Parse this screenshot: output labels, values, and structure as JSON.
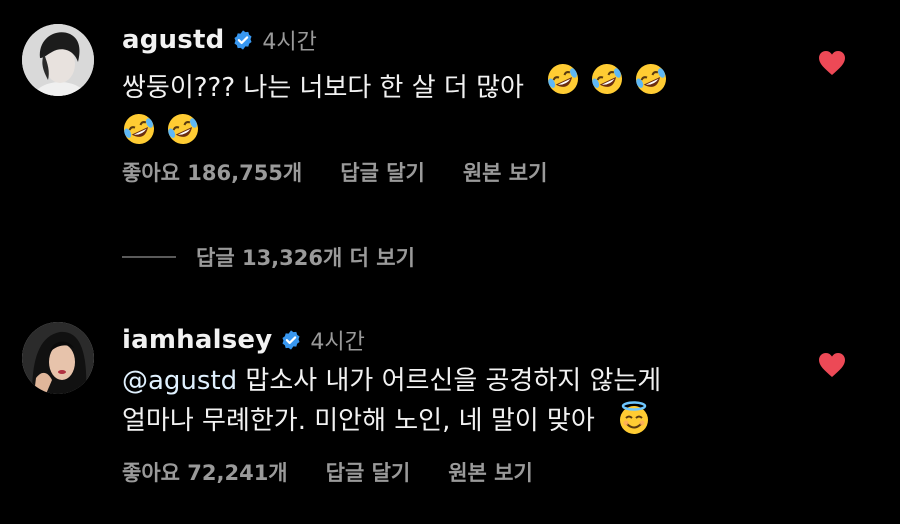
{
  "comments": [
    {
      "username": "agustd",
      "time": "4시간",
      "text_line1": "쌍둥이??? 나는 너보다 한 살 더 많아",
      "likes": "좋아요 186,755개",
      "reply_label": "답글 달기",
      "original_label": "원본 보기",
      "view_replies": "답글 13,326개 더 보기",
      "emoji_line1": [
        "rolling-on-floor-laughing",
        "rolling-on-floor-laughing",
        "rolling-on-floor-laughing"
      ],
      "emoji_line2": [
        "rolling-on-floor-laughing",
        "rolling-on-floor-laughing"
      ],
      "liked": true
    },
    {
      "username": "iamhalsey",
      "time": "4시간",
      "mention": "@agustd",
      "text_line1_rest": " 맙소사 내가 어르신을 공경하지 않는게",
      "text_line2": "얼마나 무례한가. 미안해 노인, 네 말이 맞아",
      "emoji_line2": [
        "smiling-face-with-halo"
      ],
      "likes": "좋아요 72,241개",
      "reply_label": "답글 달기",
      "original_label": "원본 보기",
      "liked": true
    }
  ],
  "colors": {
    "background": "#000000",
    "text": "#f2f2f2",
    "secondary": "#9a9a9a",
    "verified_badge": "#3897f0",
    "heart": "#ed4956"
  }
}
